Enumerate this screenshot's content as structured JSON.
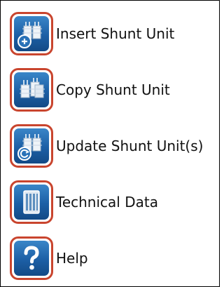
{
  "menu": {
    "items": [
      {
        "label": "Insert Shunt Unit",
        "icon": "insert-shunt-unit-icon"
      },
      {
        "label": "Copy Shunt Unit",
        "icon": "copy-shunt-unit-icon"
      },
      {
        "label": "Update Shunt Unit(s)",
        "icon": "update-shunt-unit-icon"
      },
      {
        "label": "Technical Data",
        "icon": "technical-data-icon"
      },
      {
        "label": "Help",
        "icon": "help-icon"
      }
    ]
  },
  "colors": {
    "icon_border": "#c9452e",
    "icon_blue": "#1c5fa5",
    "panel_border": "#000000",
    "text": "#111111"
  }
}
